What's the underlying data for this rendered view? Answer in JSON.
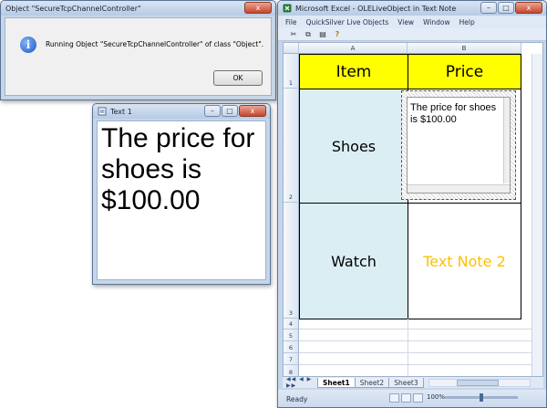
{
  "msgbox": {
    "title": "Object \"SecureTcpChannelController\"",
    "message": "Running Object \"SecureTcpChannelController\" of class \"Object\".",
    "ok_label": "OK",
    "icon": "info-icon",
    "close_glyph": "x"
  },
  "textwin": {
    "title": "Text 1",
    "content": "The price for shoes is $100.00",
    "min_glyph": "–",
    "max_glyph": "□",
    "close_glyph": "x"
  },
  "excel": {
    "title": "Microsoft Excel - OLELiveObject in Text Note",
    "menu": [
      "File",
      "QuickSilver Live Objects",
      "View",
      "Window",
      "Help"
    ],
    "columns": [
      "A",
      "B"
    ],
    "rows": [
      "1",
      "2",
      "3",
      "4",
      "5",
      "6",
      "7",
      "8"
    ],
    "cells": {
      "a1": "Item",
      "b1": "Price",
      "a2": "Shoes",
      "a3": "Watch",
      "b3": "Text Note 2"
    },
    "ole_text": "The price for shoes is $100.00",
    "tabs": [
      "Sheet1",
      "Sheet2",
      "Sheet3"
    ],
    "status": "Ready",
    "zoom": "100%",
    "min_glyph": "–",
    "max_glyph": "□",
    "close_glyph": "x",
    "colors": {
      "header_fill": "#ffff00",
      "body_fill": "#dbeef4",
      "note2_color": "#ffc000"
    }
  }
}
